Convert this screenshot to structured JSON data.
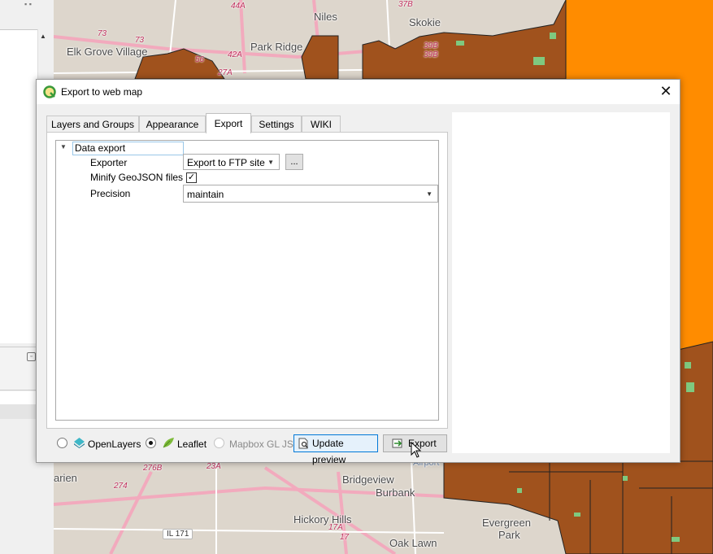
{
  "dialog": {
    "title": "Export to web map",
    "close_glyph": "✕",
    "icon": "qgis-logo-icon"
  },
  "tabs": [
    {
      "label": "Layers and Groups",
      "active": false
    },
    {
      "label": "Appearance",
      "active": false
    },
    {
      "label": "Export",
      "active": true
    },
    {
      "label": "Settings",
      "active": false
    },
    {
      "label": "WIKI",
      "active": false
    }
  ],
  "export_tab": {
    "group_label": "Data export",
    "rows": {
      "exporter_label": "Exporter",
      "exporter_value": "Export to FTP site",
      "exporter_more": "...",
      "minify_label": "Minify GeoJSON files",
      "minify_checked": true,
      "minify_mark": "✓",
      "precision_label": "Precision",
      "precision_value": "maintain"
    }
  },
  "bottom": {
    "openlayers_label": "OpenLayers",
    "leaflet_label": "Leaflet",
    "mapbox_label": "Mapbox GL JS",
    "selected_renderer": "Leaflet",
    "update_preview_label": "Update preview",
    "export_label": "Export"
  },
  "map": {
    "place_labels": [
      "Niles",
      "Skokie",
      "Park Ridge",
      "Elk Grove Village",
      "Bridgeview",
      "Burbank",
      "Hickory Hills",
      "Evergreen",
      "Park",
      "Oak Lawn",
      "arien",
      "Airport"
    ],
    "road_labels": [
      "44A",
      "37B",
      "73",
      "73",
      "42A",
      "56",
      "27A",
      "39B",
      "39B",
      "276B",
      "23A",
      "274",
      "17A",
      "17"
    ],
    "shield_label": "IL 171",
    "colors": {
      "polygons": "#a0521d",
      "water": "#ff8c00",
      "parks": "#7fc97f",
      "base": "#ddd6cc",
      "roads": "#e88aa4"
    }
  }
}
